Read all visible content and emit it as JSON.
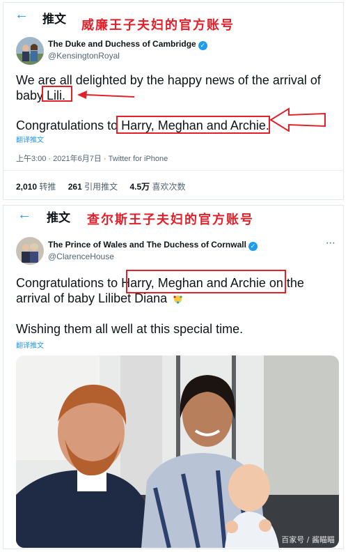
{
  "post1": {
    "header_title": "推文",
    "caption": "威廉王子夫妇的官方账号",
    "account_name": "The Duke and Duchess of Cambridge",
    "account_handle": "@KensingtonRoyal",
    "text_line1": "We are all delighted by the happy news of the arrival of",
    "text_line2_prefix": "baby ",
    "text_line2_highlight": "Lili.",
    "text_congrats_prefix": "Congratulations to ",
    "text_congrats_highlight": "Harry, Meghan and Archie.",
    "translate": "翻译推文",
    "timestamp": "上午3:00 · 2021年6月7日 · Twitter for iPhone",
    "stats": [
      {
        "count": "2,010",
        "label": "转推"
      },
      {
        "count": "261",
        "label": "引用推文"
      },
      {
        "count": "4.5万",
        "label": "喜欢次数"
      }
    ]
  },
  "post2": {
    "header_title": "推文",
    "caption": "查尔斯王子夫妇的官方账号",
    "account_name": "The Prince of Wales and The Duchess of Cornwall",
    "account_handle": "@ClarenceHouse",
    "text_congrats_prefix": "Congratulations to ",
    "text_congrats_highlight": "Harry, Meghan and Archie",
    "text_congrats_suffix": " on the",
    "text_line2": "arrival of baby Lilibet Diana",
    "text_wishing": "Wishing them all well at this special time.",
    "translate": "翻译推文",
    "photo_watermark": "百家号 / 酱瞄瞄"
  },
  "colors": {
    "accent": "#1d9bf0",
    "annotation_red": "#e3202a",
    "text": "#0f1419",
    "muted": "#536471"
  },
  "icons": {
    "back": "arrow-left-icon",
    "verified": "verified-badge-icon",
    "more": "more-dots-icon",
    "annotation_arrow": "red-arrow-icon"
  }
}
